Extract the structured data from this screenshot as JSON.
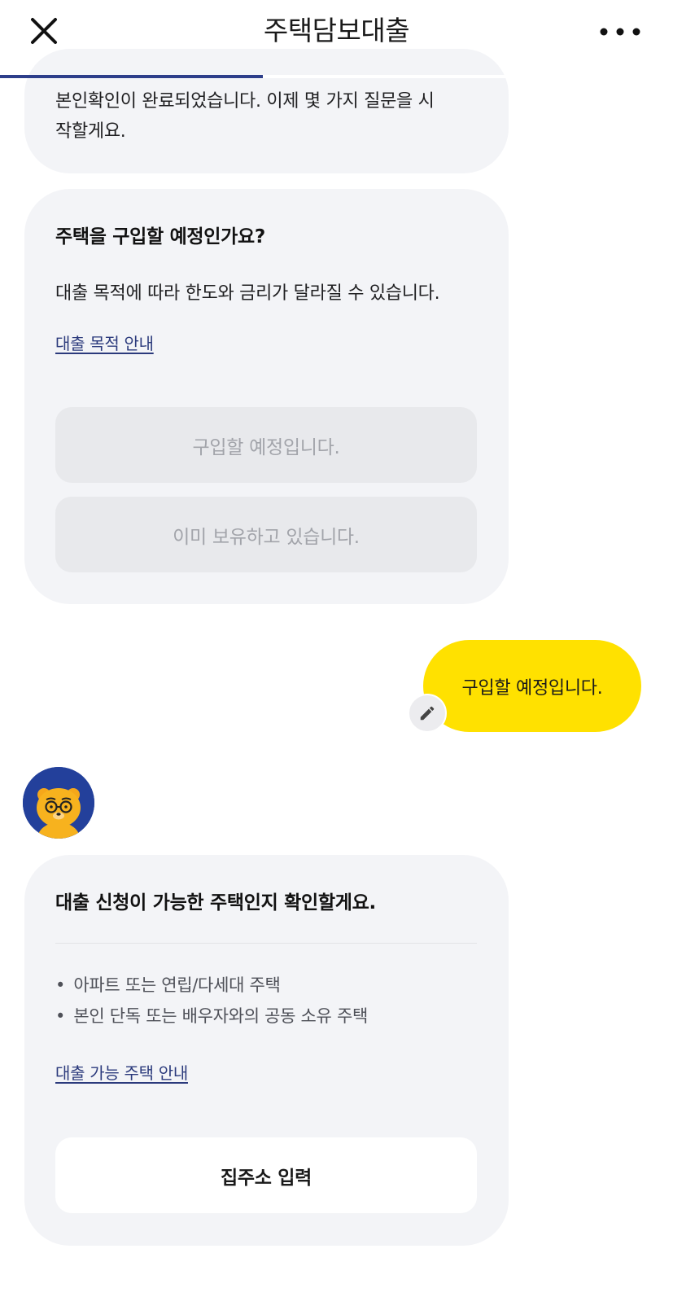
{
  "header": {
    "title": "주택담보대출",
    "progress": 0.39,
    "colors": {
      "progress": "#2d3e8a",
      "accent_yellow": "#ffe100",
      "link": "#2b3a7c"
    }
  },
  "messages": {
    "identity_msg_line1": "본인확인이 완료되었습니다. 이제 몇 가지 질문을 시",
    "identity_msg_line2": "작할게요.",
    "purchase_question": {
      "title": "주택을 구입할 예정인가요?",
      "description": "대출 목적에 따라 한도와 금리가 달라질 수 있습니다.",
      "link": "대출 목적 안내",
      "options": [
        "구입할 예정입니다.",
        "이미 보유하고 있습니다."
      ]
    },
    "user_reply": "구입할 예정입니다.",
    "house_check": {
      "title": "대출 신청이 가능한 주택인지 확인할게요.",
      "bullets": [
        "아파트 또는 연립/다세대 주택",
        "본인 단독 또는 배우자와의 공동 소유 주택"
      ],
      "link": "대출 가능 주택 안내",
      "button": "집주소 입력"
    }
  },
  "icons": {
    "close": "close-icon",
    "more": "more-icon",
    "edit": "pencil-icon",
    "avatar": "bear-character-avatar"
  },
  "bullet_glyph": "•"
}
